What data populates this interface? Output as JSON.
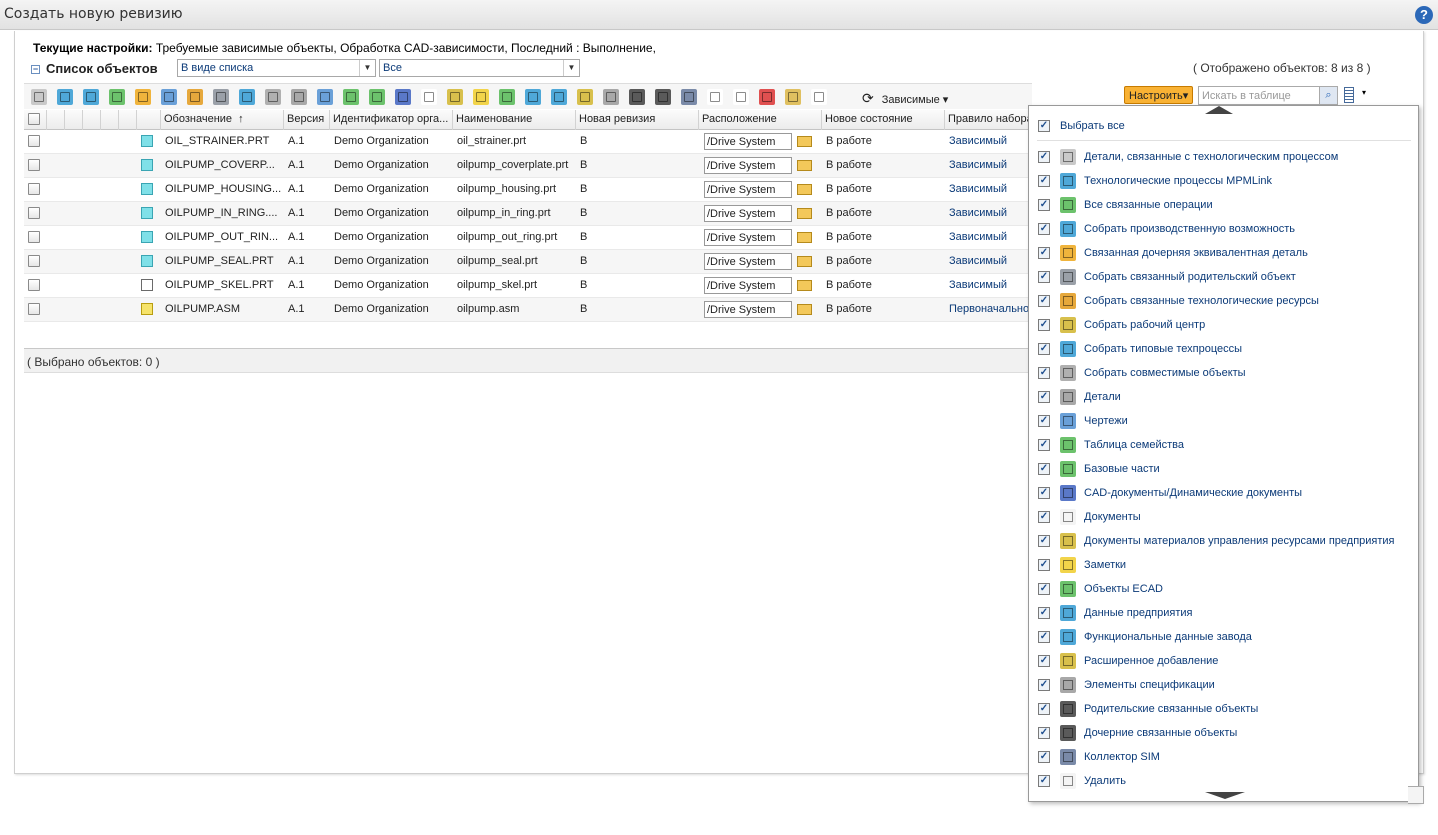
{
  "window": {
    "title": "Создать новую ревизию",
    "help_glyph": "?"
  },
  "settings": {
    "label": "Текущие настройки:",
    "value": "Требуемые зависимые объекты, Обработка CAD-зависимости, Последний : Выполнение,"
  },
  "list": {
    "title": "Список объектов",
    "view_select": "В виде списка",
    "filter_select": "Все",
    "count": "( Отображено объектов: 8 из 8 )"
  },
  "toolbar": {
    "icon_colors": [
      "#c9c9c9",
      "#4fa8d8",
      "#4fa8d8",
      "#6cc26c",
      "#f0b43c",
      "#6aa0d8",
      "#e6a83c",
      "#9aa0a8",
      "#4fa8d8",
      "#b0b0b0",
      "#a8a8a8",
      "#6aa0d8",
      "#6cc26c",
      "#6cc26c",
      "#5a78c8",
      "#ffffff",
      "#d8c04c",
      "#f2d44a",
      "#6cc26c",
      "#4fa8d8",
      "#4fa8d8",
      "#d8c04c",
      "#a8a8a8",
      "#5a5a5a",
      "#5a5a5a",
      "#7a8aa8",
      "#ffffff",
      "#ffffff",
      "#e05050",
      "#e0c060",
      "#ffffff"
    ],
    "dependents_label": "Зависимые",
    "dependents_arrow": "▾",
    "refresh_glyph": "⟳",
    "configure_label": "Настроить",
    "configure_arrow": "▾",
    "search_placeholder": "Искать в таблице",
    "search_glyph": "⌕",
    "columns_arrow": "▾"
  },
  "table": {
    "headers": {
      "number": "Обозначение",
      "sort_arrow": "↑",
      "version": "Версия",
      "org": "Идентификатор орга...",
      "name": "Наименование",
      "new_revision": "Новая ревизия",
      "location": "Расположение",
      "new_state": "Новое состояние",
      "rule": "Правило набора"
    },
    "rows": [
      {
        "number": "OIL_STRAINER.PRT",
        "version": "A.1",
        "org": "Demo Organization",
        "name": "oil_strainer.prt",
        "rev": "B",
        "location": "/Drive System",
        "state": "В работе",
        "rule": "Зависимый",
        "icon": "part"
      },
      {
        "number": "OILPUMP_COVERP...",
        "version": "A.1",
        "org": "Demo Organization",
        "name": "oilpump_coverplate.prt",
        "rev": "B",
        "location": "/Drive System",
        "state": "В работе",
        "rule": "Зависимый",
        "icon": "part"
      },
      {
        "number": "OILPUMP_HOUSING...",
        "version": "A.1",
        "org": "Demo Organization",
        "name": "oilpump_housing.prt",
        "rev": "B",
        "location": "/Drive System",
        "state": "В работе",
        "rule": "Зависимый",
        "icon": "part"
      },
      {
        "number": "OILPUMP_IN_RING....",
        "version": "A.1",
        "org": "Demo Organization",
        "name": "oilpump_in_ring.prt",
        "rev": "B",
        "location": "/Drive System",
        "state": "В работе",
        "rule": "Зависимый",
        "icon": "part"
      },
      {
        "number": "OILPUMP_OUT_RIN...",
        "version": "A.1",
        "org": "Demo Organization",
        "name": "oilpump_out_ring.prt",
        "rev": "B",
        "location": "/Drive System",
        "state": "В работе",
        "rule": "Зависимый",
        "icon": "part"
      },
      {
        "number": "OILPUMP_SEAL.PRT",
        "version": "A.1",
        "org": "Demo Organization",
        "name": "oilpump_seal.prt",
        "rev": "B",
        "location": "/Drive System",
        "state": "В работе",
        "rule": "Зависимый",
        "icon": "part"
      },
      {
        "number": "OILPUMP_SKEL.PRT",
        "version": "A.1",
        "org": "Demo Organization",
        "name": "oilpump_skel.prt",
        "rev": "B",
        "location": "/Drive System",
        "state": "В работе",
        "rule": "Зависимый",
        "icon": "skel"
      },
      {
        "number": "OILPUMP.ASM",
        "version": "A.1",
        "org": "Demo Organization",
        "name": "oilpump.asm",
        "rev": "B",
        "location": "/Drive System",
        "state": "В работе",
        "rule": "Первоначально",
        "icon": "asm"
      }
    ],
    "footer": "( Выбрано объектов: 0 )"
  },
  "dropdown": {
    "check_glyph": "✓",
    "select_all": "Выбрать все",
    "items": [
      {
        "label": "Детали, связанные с технологическим процессом",
        "color": "#c9c9c9"
      },
      {
        "label": "Технологические процессы MPMLink",
        "color": "#4fa8d8"
      },
      {
        "label": "Все связанные операции",
        "color": "#6cc26c"
      },
      {
        "label": "Собрать производственную возможность",
        "color": "#4fa8d8"
      },
      {
        "label": "Связанная дочерняя эквивалентная деталь",
        "color": "#f0b43c"
      },
      {
        "label": "Собрать связанный родительский объект",
        "color": "#9aa0a8"
      },
      {
        "label": "Собрать связанные технологические ресурсы",
        "color": "#e6a83c"
      },
      {
        "label": "Собрать рабочий центр",
        "color": "#d8c04c"
      },
      {
        "label": "Собрать типовые техпроцессы",
        "color": "#4fa8d8"
      },
      {
        "label": "Собрать совместимые объекты",
        "color": "#b0b0b0"
      },
      {
        "label": "Детали",
        "color": "#a8a8a8"
      },
      {
        "label": "Чертежи",
        "color": "#6aa0d8"
      },
      {
        "label": "Таблица семейства",
        "color": "#6cc26c"
      },
      {
        "label": "Базовые части",
        "color": "#6cc26c"
      },
      {
        "label": "CAD-документы/Динамические документы",
        "color": "#5a78c8"
      },
      {
        "label": "Документы",
        "color": "#f4f4f4"
      },
      {
        "label": "Документы материалов управления ресурсами предприятия",
        "color": "#d8c04c"
      },
      {
        "label": "Заметки",
        "color": "#f2d44a"
      },
      {
        "label": "Объекты ECAD",
        "color": "#6cc26c"
      },
      {
        "label": "Данные предприятия",
        "color": "#4fa8d8"
      },
      {
        "label": "Функциональные данные завода",
        "color": "#4fa8d8"
      },
      {
        "label": "Расширенное добавление",
        "color": "#d8c04c"
      },
      {
        "label": "Элементы спецификации",
        "color": "#a8a8a8"
      },
      {
        "label": "Родительские связанные объекты",
        "color": "#5a5a5a"
      },
      {
        "label": "Дочерние связанные объекты",
        "color": "#5a5a5a"
      },
      {
        "label": "Коллектор SIM",
        "color": "#7a8aa8"
      },
      {
        "label": "Удалить",
        "color": "#f4f4f4"
      }
    ]
  }
}
